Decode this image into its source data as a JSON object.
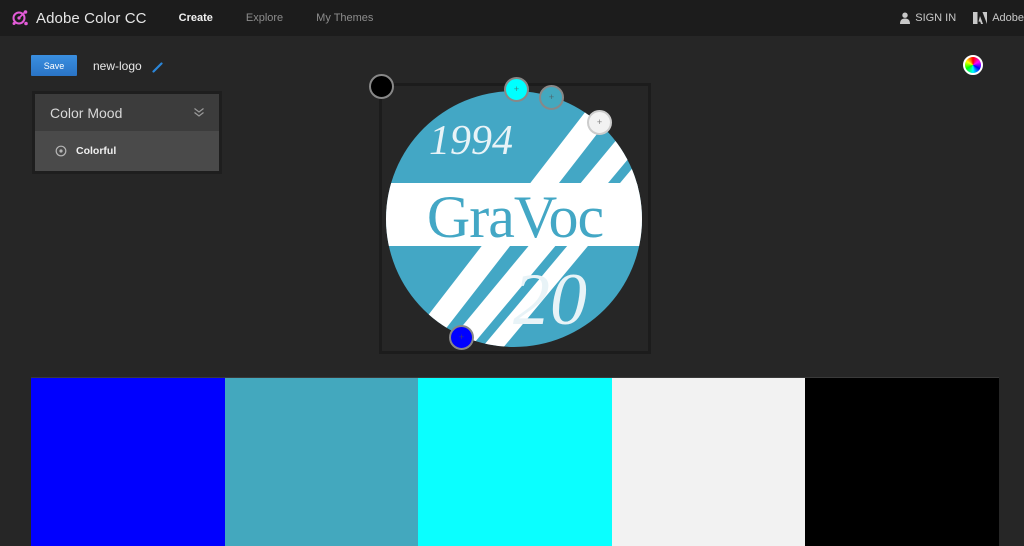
{
  "app": {
    "name": "Adobe Color CC",
    "logo_icon": "adobe-color-icon",
    "accent": "#e35bd8"
  },
  "nav": {
    "items": [
      {
        "label": "Create",
        "active": true
      },
      {
        "label": "Explore",
        "active": false
      },
      {
        "label": "My Themes",
        "active": false
      }
    ]
  },
  "account": {
    "sign_in_label": "SIGN IN",
    "sign_in_icon": "user-icon",
    "adobe_label": "Adobe",
    "adobe_icon": "adobe-logo-icon"
  },
  "toolbar": {
    "save_label": "Save",
    "theme_name": "new-logo",
    "edit_icon": "pencil-icon",
    "color_wheel_icon": "color-wheel-icon"
  },
  "color_mood": {
    "title": "Color Mood",
    "toggle_icon": "double-chevron-down-icon",
    "selected_option": "Colorful",
    "option_icon": "radio-selected-icon"
  },
  "image": {
    "top_text": "1994",
    "center_text": "GraVoc",
    "bottom_text": "20",
    "circle_color": "#43a7c5",
    "band_color": "#ffffff"
  },
  "pickers": [
    {
      "color": "#0000ff",
      "role": "blue"
    },
    {
      "color": "#43a8be",
      "role": "teal"
    },
    {
      "color": "#00ffff",
      "role": "cyan"
    },
    {
      "color": "#f2f2f2",
      "role": "white"
    },
    {
      "color": "#000000",
      "role": "black"
    }
  ],
  "swatches": [
    {
      "color": "#0000ff"
    },
    {
      "color": "#43a8be"
    },
    {
      "color": "#0affff"
    },
    {
      "color": "#f2f2f2"
    },
    {
      "color": "#000000"
    }
  ]
}
